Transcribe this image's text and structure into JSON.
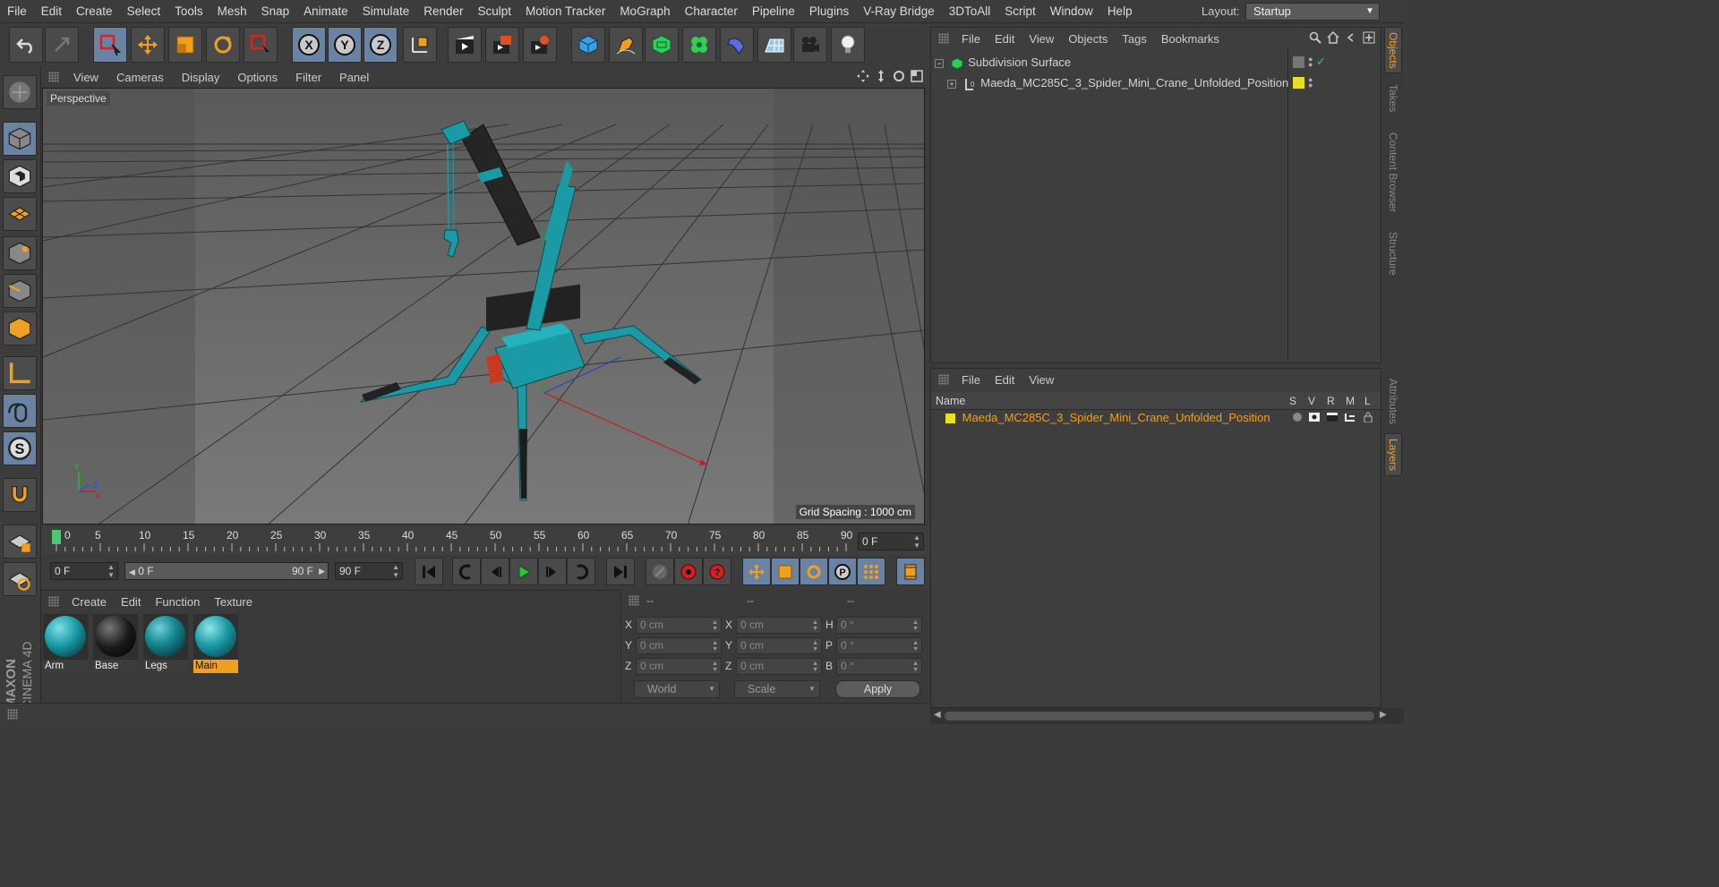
{
  "menubar": {
    "items": [
      "File",
      "Edit",
      "Create",
      "Select",
      "Tools",
      "Mesh",
      "Snap",
      "Animate",
      "Simulate",
      "Render",
      "Sculpt",
      "Motion Tracker",
      "MoGraph",
      "Character",
      "Pipeline",
      "Plugins",
      "V-Ray Bridge",
      "3DToAll",
      "Script",
      "Window",
      "Help"
    ],
    "layout_label": "Layout:",
    "layout_value": "Startup"
  },
  "toolbar": {
    "icons": [
      "undo-icon",
      "redo-icon",
      "live-selection-icon",
      "move-icon",
      "scale-icon",
      "rotate-icon",
      "recent-tool-icon",
      "x-axis-icon",
      "y-axis-icon",
      "z-axis-icon",
      "coordinate-system-icon",
      "render-view-icon",
      "render-picture-viewer-icon",
      "edit-render-settings-icon",
      "cube-icon",
      "pen-icon",
      "subdivision-surface-icon",
      "cloner-icon",
      "deformer-icon",
      "floor-icon",
      "camera-icon",
      "light-icon"
    ],
    "axis_x": "X",
    "axis_y": "Y",
    "axis_z": "Z"
  },
  "viewport": {
    "menu": [
      "View",
      "Cameras",
      "Display",
      "Options",
      "Filter",
      "Panel"
    ],
    "label": "Perspective",
    "grid_spacing": "Grid Spacing : 1000 cm",
    "axis_x": "X",
    "axis_y": "Y",
    "axis_z": "Z"
  },
  "timeline": {
    "ticks": [
      "0",
      "5",
      "10",
      "15",
      "20",
      "25",
      "30",
      "35",
      "40",
      "45",
      "50",
      "55",
      "60",
      "65",
      "70",
      "75",
      "80",
      "85",
      "90"
    ],
    "current_frame": "0 F",
    "start_field": "0 F",
    "range_start": "0 F",
    "range_end": "90 F",
    "end_field": "90 F",
    "range_left_arrow": "◀",
    "range_right_arrow": "▶"
  },
  "materials": {
    "menu": [
      "Create",
      "Edit",
      "Function",
      "Texture"
    ],
    "items": [
      {
        "name": "Arm",
        "selected": false
      },
      {
        "name": "Base",
        "selected": false
      },
      {
        "name": "Legs",
        "selected": false
      },
      {
        "name": "Main",
        "selected": true
      }
    ]
  },
  "coordinates": {
    "headers": [
      "--",
      "--",
      "--"
    ],
    "rows": [
      {
        "l1": "X",
        "v1": "0 cm",
        "l2": "X",
        "v2": "0 cm",
        "l3": "H",
        "v3": "0 °"
      },
      {
        "l1": "Y",
        "v1": "0 cm",
        "l2": "Y",
        "v2": "0 cm",
        "l3": "P",
        "v3": "0 °"
      },
      {
        "l1": "Z",
        "v1": "0 cm",
        "l2": "Z",
        "v2": "0 cm",
        "l3": "B",
        "v3": "0 °"
      }
    ],
    "mode": "World",
    "type": "Scale",
    "apply": "Apply"
  },
  "objects": {
    "menu": [
      "File",
      "Edit",
      "View",
      "Objects",
      "Tags",
      "Bookmarks"
    ],
    "items": [
      {
        "name": "Subdivision Surface",
        "color": "#d4d4d4"
      },
      {
        "name": "Maeda_MC285C_3_Spider_Mini_Crane_Unfolded_Position",
        "color": "#d4d4d4"
      }
    ]
  },
  "layers": {
    "menu": [
      "File",
      "Edit",
      "View"
    ],
    "col_name": "Name",
    "cols": [
      "S",
      "V",
      "R",
      "M",
      "L"
    ],
    "items": [
      {
        "name": "Maeda_MC285C_3_Spider_Mini_Crane_Unfolded_Position",
        "color": "#f0a020"
      }
    ]
  },
  "side_tabs": {
    "top": [
      "Objects",
      "Takes",
      "Content Browser",
      "Structure"
    ],
    "bottom": [
      "Attributes",
      "Layers"
    ]
  },
  "brand": {
    "maxon": "MAXON",
    "cinema": "CINEMA 4D"
  },
  "colors": {
    "accent": "#f0a020",
    "selected_tool": "#6b83a3",
    "crane_teal": "#1a9aa5"
  }
}
